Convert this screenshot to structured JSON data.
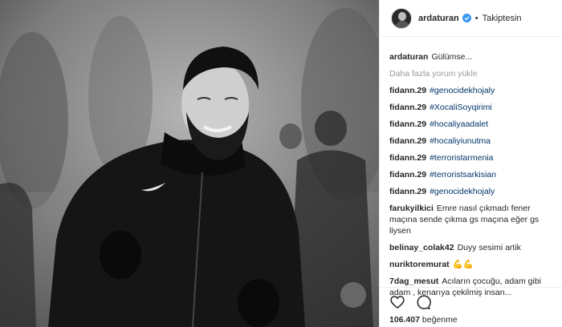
{
  "post": {
    "username": "ardaturan",
    "follow_label": "Takiptesin",
    "caption_user": "ardaturan",
    "caption_text": "Gülümse..."
  },
  "load_more": "Daha fazla yorum yükle",
  "comments": [
    {
      "user": "fidann.29",
      "text": "#genocidekhojaly",
      "is_tag": true
    },
    {
      "user": "fidann.29",
      "text": "#XocaliSoyqirimi",
      "is_tag": true
    },
    {
      "user": "fidann.29",
      "text": "#hocaliyaadalet",
      "is_tag": true
    },
    {
      "user": "fidann.29",
      "text": "#hocaliyiunutma",
      "is_tag": true
    },
    {
      "user": "fidann.29",
      "text": "#terroristarmenia",
      "is_tag": true
    },
    {
      "user": "fidann.29",
      "text": "#terroristsarkisian",
      "is_tag": true
    },
    {
      "user": "fidann.29",
      "text": "#genocidekhojaly",
      "is_tag": true
    },
    {
      "user": "farukyilkici",
      "text": "Emre nasıl çıkmadı fener maçına sende çıkma gs maçına eğer gs liysen",
      "is_tag": false
    },
    {
      "user": "belinay_colak42",
      "text": "Duyy sesimi artik",
      "is_tag": false
    },
    {
      "user": "nuriktoremurat",
      "text": "💪💪",
      "is_tag": false
    },
    {
      "user": "7dag_mesut",
      "text": "Acıların çocuğu, adam gibi adam , kenarıya çekilmiş insan...",
      "is_tag": false
    }
  ],
  "likes": {
    "count": "106.407",
    "label": "beğenme"
  },
  "icons": {
    "verified": "verified-badge-icon",
    "like": "heart-icon",
    "comment": "comment-icon"
  },
  "colors": {
    "verified_blue": "#3897f0",
    "hashtag": "#003569",
    "muted": "#999999"
  }
}
